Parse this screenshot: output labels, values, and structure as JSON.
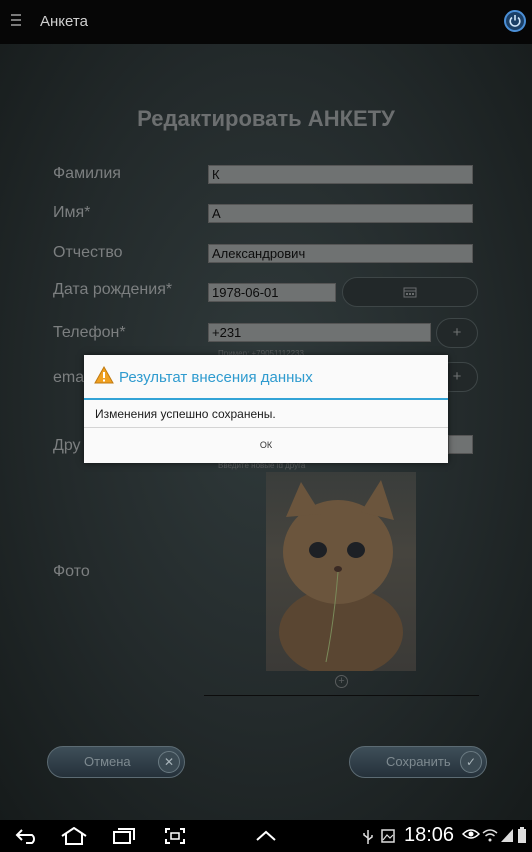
{
  "app": {
    "title": "Анкета"
  },
  "form": {
    "title": "Редактировать АНКЕТУ",
    "fields": [
      {
        "label": "Фамилия",
        "value": "К"
      },
      {
        "label": "Имя*",
        "value": "А"
      },
      {
        "label": "Отчество",
        "value": "Александрович"
      },
      {
        "label": "Дата рождения*",
        "value": "1978-06-01"
      },
      {
        "label": "Телефон*",
        "value": "+231"
      },
      {
        "label": "ema"
      },
      {
        "label": "Дру"
      },
      {
        "label": "Фото"
      }
    ],
    "phone_hint": "Пример: +79051112233",
    "friend_hint": "Введите новые id друга",
    "phone_add": "+",
    "email_add": "+",
    "photo_add": "+"
  },
  "buttons": {
    "cancel": "Отмена",
    "save": "Сохранить"
  },
  "dialog": {
    "title": "Результат внесения данных",
    "message": "Изменения успешно сохранены.",
    "ok": "ОК"
  },
  "statusbar": {
    "time": "18:06"
  },
  "colors": {
    "accent": "#33a3d6",
    "warning": "#f0a020"
  }
}
